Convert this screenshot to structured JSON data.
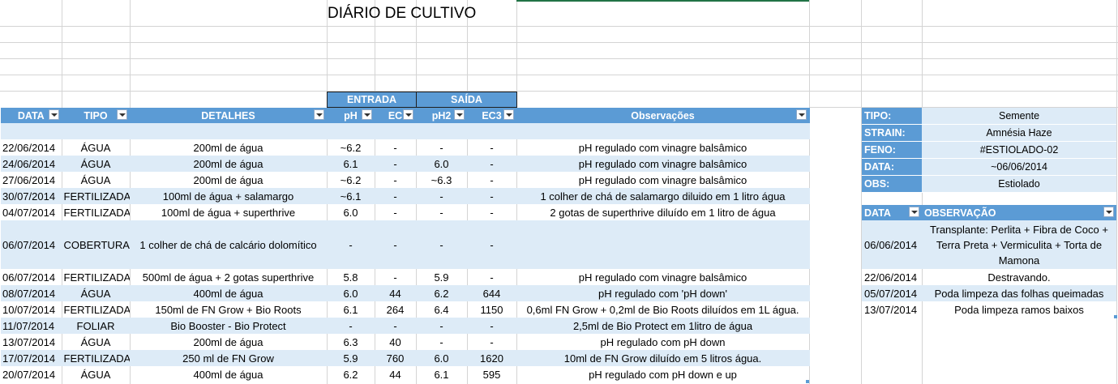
{
  "title": "DIÁRIO DE CULTIVO",
  "group_headers": {
    "entrada": "ENTRADA",
    "saida": "SAÍDA"
  },
  "columns": [
    "DATA",
    "TIPO",
    "DETALHES",
    "pH",
    "EC",
    "pH2",
    "EC3",
    "Observações"
  ],
  "rows": [
    [
      "22/06/2014",
      "ÁGUA",
      "200ml de água",
      "~6.2",
      "-",
      "-",
      "-",
      "pH regulado com vinagre balsâmico"
    ],
    [
      "24/06/2014",
      "ÁGUA",
      "200ml de água",
      "6.1",
      "-",
      "6.0",
      "-",
      "pH regulado com vinagre balsâmico"
    ],
    [
      "27/06/2014",
      "ÁGUA",
      "200ml de água",
      "~6.2",
      "-",
      "~6.3",
      "-",
      "pH regulado com vinagre balsâmico"
    ],
    [
      "30/07/2014",
      "FERTILIZADA",
      "100ml de água + salamargo",
      "~6.1",
      "-",
      "-",
      "-",
      "1 colher de chá de salamargo diluido em 1 litro água"
    ],
    [
      "04/07/2014",
      "FERTILIZADA",
      "100ml de água + superthrive",
      "6.0",
      "-",
      "-",
      "-",
      "2 gotas de superthrive diluído em 1 litro de água"
    ],
    [
      "06/07/2014",
      "COBERTURA",
      "1 colher de chá de calcário dolomítico",
      "-",
      "-",
      "-",
      "-",
      ""
    ],
    [
      "06/07/2014",
      "FERTILIZADA",
      "500ml de água + 2 gotas superthrive",
      "5.8",
      "-",
      "5.9",
      "-",
      "pH regulado com vinagre balsâmico"
    ],
    [
      "08/07/2014",
      "ÁGUA",
      "400ml de água",
      "6.0",
      "44",
      "6.2",
      "644",
      "pH regulado com 'pH down'"
    ],
    [
      "10/07/2014",
      "FERTILIZADA",
      "150ml de FN Grow + Bio Roots",
      "6.1",
      "264",
      "6.4",
      "1150",
      "0,6ml FN Grow + 0,2ml de Bio Roots diluídos em 1L água."
    ],
    [
      "11/07/2014",
      "FOLIAR",
      "Bio Booster - Bio Protect",
      "-",
      "-",
      "-",
      "-",
      "2,5ml de Bio Protect em 1litro de água"
    ],
    [
      "13/07/2014",
      "ÁGUA",
      "200ml de água",
      "6.3",
      "40",
      "-",
      "-",
      "pH regulado com pH down"
    ],
    [
      "17/07/2014",
      "FERTILIZADA",
      "250 ml de FN Grow",
      "5.9",
      "760",
      "6.0",
      "1620",
      "10ml de FN Grow diluído em 5 litros água."
    ],
    [
      "20/07/2014",
      "ÁGUA",
      "400ml de água",
      "6.2",
      "44",
      "6.1",
      "595",
      "pH regulado com pH down e up"
    ]
  ],
  "info": [
    {
      "label": "TIPO:",
      "value": "Semente"
    },
    {
      "label": "STRAIN:",
      "value": "Amnésia Haze"
    },
    {
      "label": "FENO:",
      "value": "#ESTIOLADO-02"
    },
    {
      "label": "DATA:",
      "value": "~06/06/2014"
    },
    {
      "label": "OBS:",
      "value": "Estiolado"
    }
  ],
  "log_headers": [
    "DATA",
    "OBSERVAÇÃO"
  ],
  "log": [
    [
      "06/06/2014",
      "Transplante: Perlita + Fibra de Coco + Terra Preta + Vermiculita + Torta de Mamona"
    ],
    [
      "22/06/2014",
      "Destravando."
    ],
    [
      "05/07/2014",
      "Poda limpeza das folhas queimadas"
    ],
    [
      "13/07/2014",
      "Poda limpeza ramos baixos"
    ]
  ]
}
